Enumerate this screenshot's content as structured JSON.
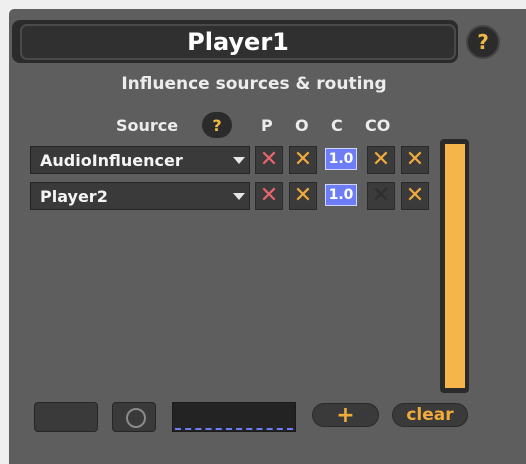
{
  "header": {
    "title": "Player1",
    "help_label": "?"
  },
  "routing": {
    "subtitle": "Influence sources & routing",
    "source_label": "Source",
    "source_help_label": "?",
    "columns": [
      "P",
      "O",
      "C",
      "CO"
    ],
    "rows": [
      {
        "source": "AudioInfluencer",
        "p": "✕",
        "o": "✕",
        "c": "1.0",
        "co_a": "✕",
        "co_b": "✕"
      },
      {
        "source": "Player2",
        "p": "✕",
        "o": "✕",
        "c": "1.0",
        "co_a": "✕",
        "co_b": "✕"
      }
    ]
  },
  "footer": {
    "add_label": "+",
    "clear_label": "clear"
  },
  "colors": {
    "accent": "#f2ab3a",
    "disable_x": "#e8676c",
    "number_fill": "#6d7df7",
    "meter": "#f5b54a"
  },
  "icons": {
    "help": "question-icon",
    "dropdown": "chevron-down-icon",
    "toggle": "x-icon",
    "record": "circle-icon"
  },
  "meter_level": 1.0
}
